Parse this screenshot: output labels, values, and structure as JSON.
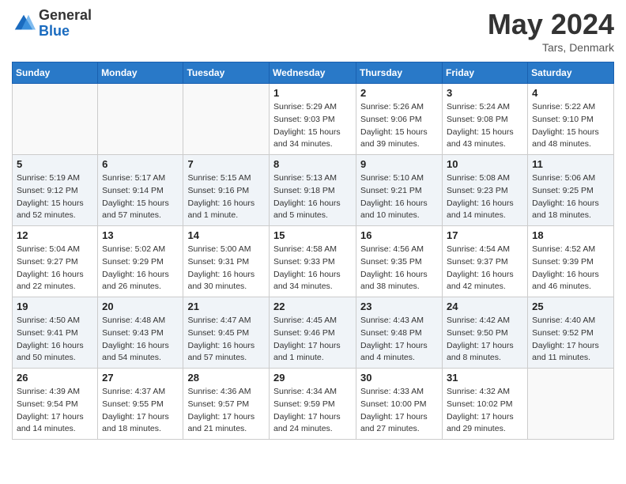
{
  "header": {
    "logo_general": "General",
    "logo_blue": "Blue",
    "month_year": "May 2024",
    "location": "Tars, Denmark"
  },
  "weekdays": [
    "Sunday",
    "Monday",
    "Tuesday",
    "Wednesday",
    "Thursday",
    "Friday",
    "Saturday"
  ],
  "weeks": [
    [
      {
        "day": "",
        "info": ""
      },
      {
        "day": "",
        "info": ""
      },
      {
        "day": "",
        "info": ""
      },
      {
        "day": "1",
        "info": "Sunrise: 5:29 AM\nSunset: 9:03 PM\nDaylight: 15 hours\nand 34 minutes."
      },
      {
        "day": "2",
        "info": "Sunrise: 5:26 AM\nSunset: 9:06 PM\nDaylight: 15 hours\nand 39 minutes."
      },
      {
        "day": "3",
        "info": "Sunrise: 5:24 AM\nSunset: 9:08 PM\nDaylight: 15 hours\nand 43 minutes."
      },
      {
        "day": "4",
        "info": "Sunrise: 5:22 AM\nSunset: 9:10 PM\nDaylight: 15 hours\nand 48 minutes."
      }
    ],
    [
      {
        "day": "5",
        "info": "Sunrise: 5:19 AM\nSunset: 9:12 PM\nDaylight: 15 hours\nand 52 minutes."
      },
      {
        "day": "6",
        "info": "Sunrise: 5:17 AM\nSunset: 9:14 PM\nDaylight: 15 hours\nand 57 minutes."
      },
      {
        "day": "7",
        "info": "Sunrise: 5:15 AM\nSunset: 9:16 PM\nDaylight: 16 hours\nand 1 minute."
      },
      {
        "day": "8",
        "info": "Sunrise: 5:13 AM\nSunset: 9:18 PM\nDaylight: 16 hours\nand 5 minutes."
      },
      {
        "day": "9",
        "info": "Sunrise: 5:10 AM\nSunset: 9:21 PM\nDaylight: 16 hours\nand 10 minutes."
      },
      {
        "day": "10",
        "info": "Sunrise: 5:08 AM\nSunset: 9:23 PM\nDaylight: 16 hours\nand 14 minutes."
      },
      {
        "day": "11",
        "info": "Sunrise: 5:06 AM\nSunset: 9:25 PM\nDaylight: 16 hours\nand 18 minutes."
      }
    ],
    [
      {
        "day": "12",
        "info": "Sunrise: 5:04 AM\nSunset: 9:27 PM\nDaylight: 16 hours\nand 22 minutes."
      },
      {
        "day": "13",
        "info": "Sunrise: 5:02 AM\nSunset: 9:29 PM\nDaylight: 16 hours\nand 26 minutes."
      },
      {
        "day": "14",
        "info": "Sunrise: 5:00 AM\nSunset: 9:31 PM\nDaylight: 16 hours\nand 30 minutes."
      },
      {
        "day": "15",
        "info": "Sunrise: 4:58 AM\nSunset: 9:33 PM\nDaylight: 16 hours\nand 34 minutes."
      },
      {
        "day": "16",
        "info": "Sunrise: 4:56 AM\nSunset: 9:35 PM\nDaylight: 16 hours\nand 38 minutes."
      },
      {
        "day": "17",
        "info": "Sunrise: 4:54 AM\nSunset: 9:37 PM\nDaylight: 16 hours\nand 42 minutes."
      },
      {
        "day": "18",
        "info": "Sunrise: 4:52 AM\nSunset: 9:39 PM\nDaylight: 16 hours\nand 46 minutes."
      }
    ],
    [
      {
        "day": "19",
        "info": "Sunrise: 4:50 AM\nSunset: 9:41 PM\nDaylight: 16 hours\nand 50 minutes."
      },
      {
        "day": "20",
        "info": "Sunrise: 4:48 AM\nSunset: 9:43 PM\nDaylight: 16 hours\nand 54 minutes."
      },
      {
        "day": "21",
        "info": "Sunrise: 4:47 AM\nSunset: 9:45 PM\nDaylight: 16 hours\nand 57 minutes."
      },
      {
        "day": "22",
        "info": "Sunrise: 4:45 AM\nSunset: 9:46 PM\nDaylight: 17 hours\nand 1 minute."
      },
      {
        "day": "23",
        "info": "Sunrise: 4:43 AM\nSunset: 9:48 PM\nDaylight: 17 hours\nand 4 minutes."
      },
      {
        "day": "24",
        "info": "Sunrise: 4:42 AM\nSunset: 9:50 PM\nDaylight: 17 hours\nand 8 minutes."
      },
      {
        "day": "25",
        "info": "Sunrise: 4:40 AM\nSunset: 9:52 PM\nDaylight: 17 hours\nand 11 minutes."
      }
    ],
    [
      {
        "day": "26",
        "info": "Sunrise: 4:39 AM\nSunset: 9:54 PM\nDaylight: 17 hours\nand 14 minutes."
      },
      {
        "day": "27",
        "info": "Sunrise: 4:37 AM\nSunset: 9:55 PM\nDaylight: 17 hours\nand 18 minutes."
      },
      {
        "day": "28",
        "info": "Sunrise: 4:36 AM\nSunset: 9:57 PM\nDaylight: 17 hours\nand 21 minutes."
      },
      {
        "day": "29",
        "info": "Sunrise: 4:34 AM\nSunset: 9:59 PM\nDaylight: 17 hours\nand 24 minutes."
      },
      {
        "day": "30",
        "info": "Sunrise: 4:33 AM\nSunset: 10:00 PM\nDaylight: 17 hours\nand 27 minutes."
      },
      {
        "day": "31",
        "info": "Sunrise: 4:32 AM\nSunset: 10:02 PM\nDaylight: 17 hours\nand 29 minutes."
      },
      {
        "day": "",
        "info": ""
      }
    ]
  ]
}
